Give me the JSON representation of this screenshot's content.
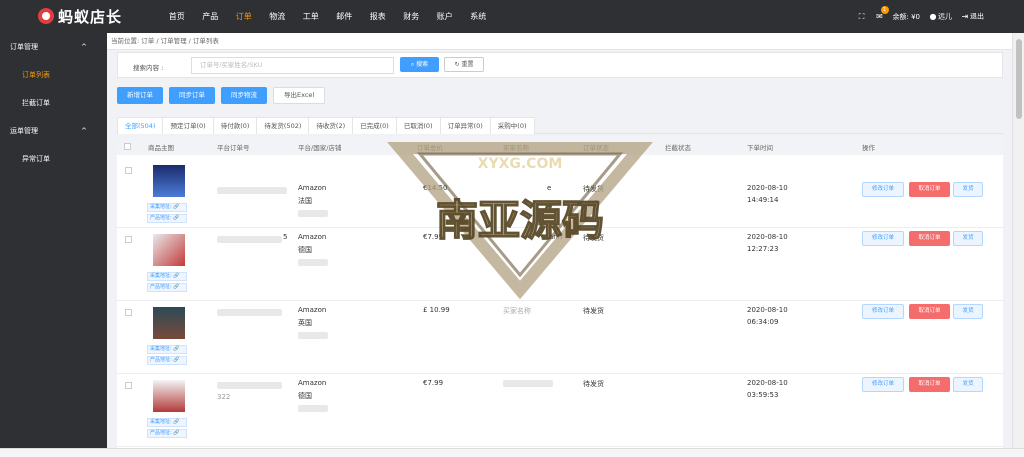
{
  "app": {
    "logo_text": "蚂蚁店长"
  },
  "nav": [
    "首页",
    "产品",
    "订单",
    "物流",
    "工单",
    "邮件",
    "报表",
    "财务",
    "账户",
    "系统"
  ],
  "nav_active": 2,
  "topright": {
    "badge": "1",
    "balance": "余额: ¥0",
    "user": "远儿",
    "logout": "退出"
  },
  "sidebar": {
    "groups": [
      {
        "label": "订单管理",
        "items": [
          "订单列表",
          "拦截订单"
        ]
      },
      {
        "label": "运单管理",
        "items": [
          "异常订单"
        ]
      }
    ]
  },
  "breadcrumb": "当前位置: 订单  /  订单管理  /  订单列表",
  "search": {
    "label": "搜索内容 :",
    "placeholder": "订单号/买家姓名/SKU",
    "search_button": "搜索",
    "reset_button": "重置"
  },
  "actions": [
    "新增订单",
    "同步订单",
    "同步物流",
    "导出Excel"
  ],
  "tabs": [
    "全部(504)",
    "预定订单(0)",
    "待付款(0)",
    "待发货(502)",
    "待收货(2)",
    "已完成(0)",
    "已取消(0)",
    "订单异常(0)",
    "采购中(0)"
  ],
  "table": {
    "headers": [
      "商品主图",
      "平台订单号",
      "平台/国家/店铺",
      "订单总价",
      "买家名称",
      "订单状态",
      "拦截状态",
      "下单时间",
      "操作"
    ],
    "link_labels": [
      "采集地址: ",
      "产品地址: "
    ],
    "row_buttons": [
      "修改订单",
      "取消订单",
      "发货"
    ],
    "rows": [
      {
        "platform": "Amazon",
        "country": "法国",
        "order_no_suffix": "",
        "price": "€14.50",
        "buyer": "",
        "buyer_suffix": "e",
        "status": "待发货",
        "date": "2020-08-10",
        "time": "14:49:14"
      },
      {
        "platform": "Amazon",
        "country": "德国",
        "order_no_suffix": "5",
        "price": "€7.99",
        "buyer": "",
        "buyer_suffix": "ann",
        "status": "待发货",
        "date": "2020-08-10",
        "time": "12:27:23"
      },
      {
        "platform": "Amazon",
        "country": "英国",
        "order_no_suffix": "",
        "price": "£ 10.99",
        "buyer": "买家名称",
        "buyer_suffix": "",
        "status": "待发货",
        "date": "2020-08-10",
        "time": "06:34:09"
      },
      {
        "platform": "Amazon",
        "country": "德国",
        "order_no_suffix": "322",
        "price": "€7.99",
        "buyer": "",
        "buyer_suffix": "",
        "status": "待发货",
        "date": "2020-08-10",
        "time": "03:59:53"
      }
    ]
  },
  "watermark": {
    "top": "XYXG.COM",
    "main": "南亚源码"
  },
  "colors": {
    "primary": "#409eff",
    "danger": "#f56c6c",
    "accent": "#ff9900",
    "dark": "#2e3033"
  }
}
